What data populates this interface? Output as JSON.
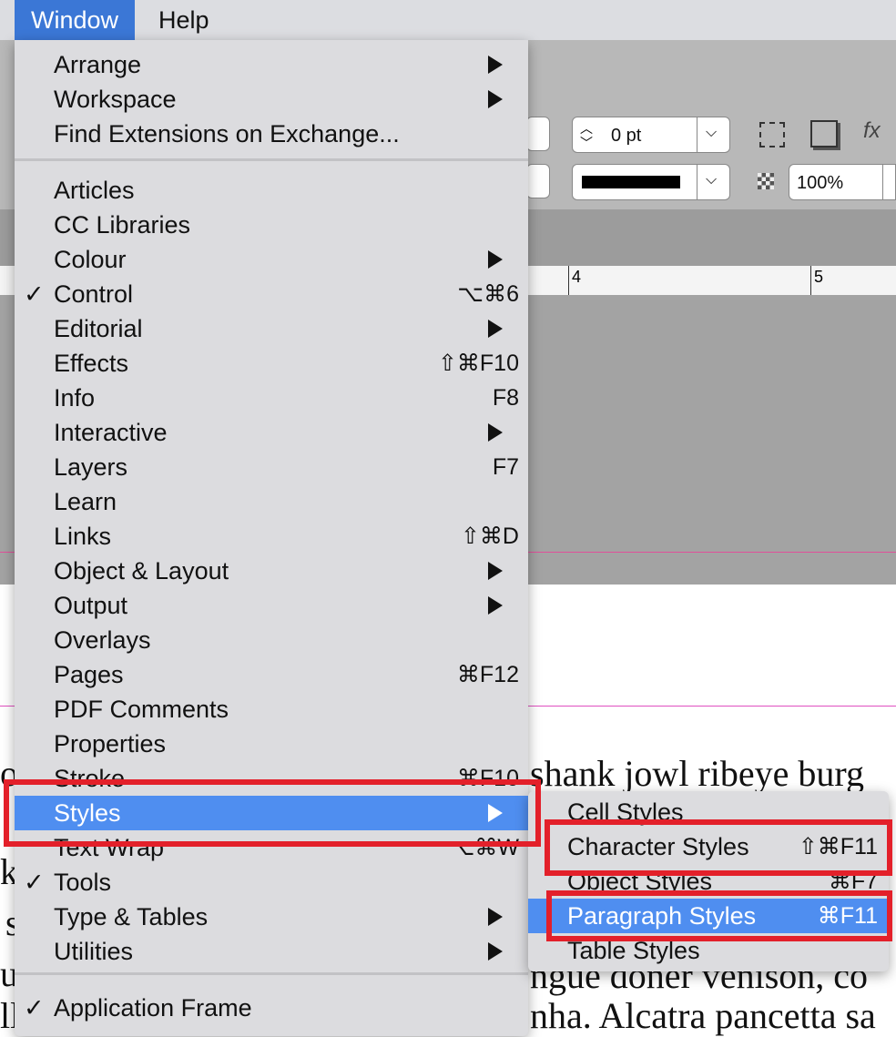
{
  "menubar": {
    "items": [
      {
        "label": "Window",
        "active": true
      },
      {
        "label": "Help",
        "active": false
      }
    ]
  },
  "toolbar": {
    "stroke_weight": "0 pt",
    "opacity": "100%",
    "fx_label": "fx"
  },
  "ruler": {
    "marks": [
      "4",
      "5"
    ]
  },
  "document": {
    "lines": [
      "shank jowl ribeye burg",
      "ngue doner venison, co",
      "nha. Alcatra pancetta sa"
    ],
    "left_fragments": [
      "o",
      "k",
      "s",
      "u",
      "ll"
    ]
  },
  "window_menu": {
    "items": [
      {
        "label": "Arrange",
        "submenu": true
      },
      {
        "label": "Workspace",
        "submenu": true
      },
      {
        "label": "Find Extensions on Exchange..."
      },
      {
        "label": "Articles"
      },
      {
        "label": "CC Libraries"
      },
      {
        "label": "Colour",
        "submenu": true
      },
      {
        "label": "Control",
        "checked": true,
        "shortcut": "⌥⌘6"
      },
      {
        "label": "Editorial",
        "submenu": true
      },
      {
        "label": "Effects",
        "shortcut": "⇧⌘F10"
      },
      {
        "label": "Info",
        "shortcut": "F8"
      },
      {
        "label": "Interactive",
        "submenu": true
      },
      {
        "label": "Layers",
        "shortcut": "F7"
      },
      {
        "label": "Learn"
      },
      {
        "label": "Links",
        "shortcut": "⇧⌘D"
      },
      {
        "label": "Object & Layout",
        "submenu": true
      },
      {
        "label": "Output",
        "submenu": true
      },
      {
        "label": "Overlays"
      },
      {
        "label": "Pages",
        "shortcut": "⌘F12"
      },
      {
        "label": "PDF Comments"
      },
      {
        "label": "Properties"
      },
      {
        "label": "Stroke",
        "shortcut": "⌘F10"
      },
      {
        "label": "Styles",
        "submenu": true,
        "highlighted": true
      },
      {
        "label": "Text Wrap",
        "shortcut": "⌥⌘W"
      },
      {
        "label": "Tools",
        "checked": true
      },
      {
        "label": "Type & Tables",
        "submenu": true
      },
      {
        "label": "Utilities",
        "submenu": true
      },
      {
        "label": "Application Frame",
        "checked": true
      }
    ],
    "check_glyph": "✓"
  },
  "styles_submenu": {
    "items": [
      {
        "label": "Cell Styles"
      },
      {
        "label": "Character Styles",
        "shortcut": "⇧⌘F11"
      },
      {
        "label": "Object Styles",
        "shortcut": "⌘F7"
      },
      {
        "label": "Paragraph Styles",
        "shortcut": "⌘F11",
        "highlighted": true
      },
      {
        "label": "Table Styles"
      }
    ]
  },
  "colors": {
    "highlight": "#4f8ef0",
    "annotation": "#e3202a",
    "menubar_active": "#3b77d6"
  }
}
